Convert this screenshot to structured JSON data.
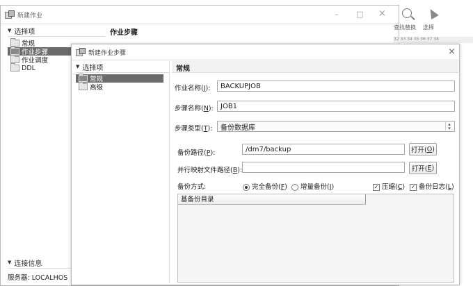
{
  "main_window": {
    "title": "新建作业",
    "left_panel_header": "选择项",
    "tree": [
      {
        "label": "常规",
        "selected": false
      },
      {
        "label": "作业步骤",
        "selected": true
      },
      {
        "label": "作业调度",
        "selected": false
      },
      {
        "label": "DDL",
        "selected": false
      }
    ],
    "content_header": "作业步骤",
    "connection_header": "连接信息",
    "server_label": "服务器: LOCALHOS",
    "window_controls": {
      "minimize": "–",
      "maximize": "□",
      "close": "×"
    }
  },
  "background_toolbar": {
    "search_label": "查找替换",
    "select_label": "选择",
    "ruler": "32  33  34  35  36  37  38"
  },
  "dialog": {
    "title": "新建作业步骤",
    "close": "×",
    "left_panel_header": "选择项",
    "tree": [
      {
        "label": "常规",
        "selected": true
      },
      {
        "label": "高级",
        "selected": false
      }
    ],
    "section_header": "常规",
    "job_name": {
      "label_pre": "作业名称(",
      "key": "J",
      "label_post": "):",
      "value": "BACKUPJOB"
    },
    "step_name": {
      "label_pre": "步骤名称(",
      "key": "N",
      "label_post": "):",
      "value": "JOB1"
    },
    "step_type": {
      "label_pre": "步骤类型(",
      "key": "T",
      "label_post": "):",
      "value": "备份数据库"
    },
    "backup_path": {
      "label_pre": "备份路径(",
      "key": "P",
      "label_post": "):",
      "value": "/dm7/backup",
      "button_pre": "打开(",
      "button_key": "O",
      "button_post": ")"
    },
    "mapfile_path": {
      "label_pre": "并行映射文件路径(",
      "key": "B",
      "label_post": "):",
      "value": "",
      "button_pre": "打开(",
      "button_key": "E",
      "button_post": ")"
    },
    "backup_mode": {
      "label": "备份方式:",
      "full_pre": "完全备份(",
      "full_key": "F",
      "full_post": ")",
      "incr_pre": "增量备份(",
      "incr_key": "I",
      "incr_post": ")"
    },
    "compress": {
      "pre": "压缩(",
      "key": "C",
      "post": ")",
      "checked": true
    },
    "backup_log": {
      "pre": "备份日志(",
      "key": "L",
      "post": ")",
      "checked": true
    },
    "base_dir_header": "基备份目录",
    "check_mark": "✓"
  }
}
